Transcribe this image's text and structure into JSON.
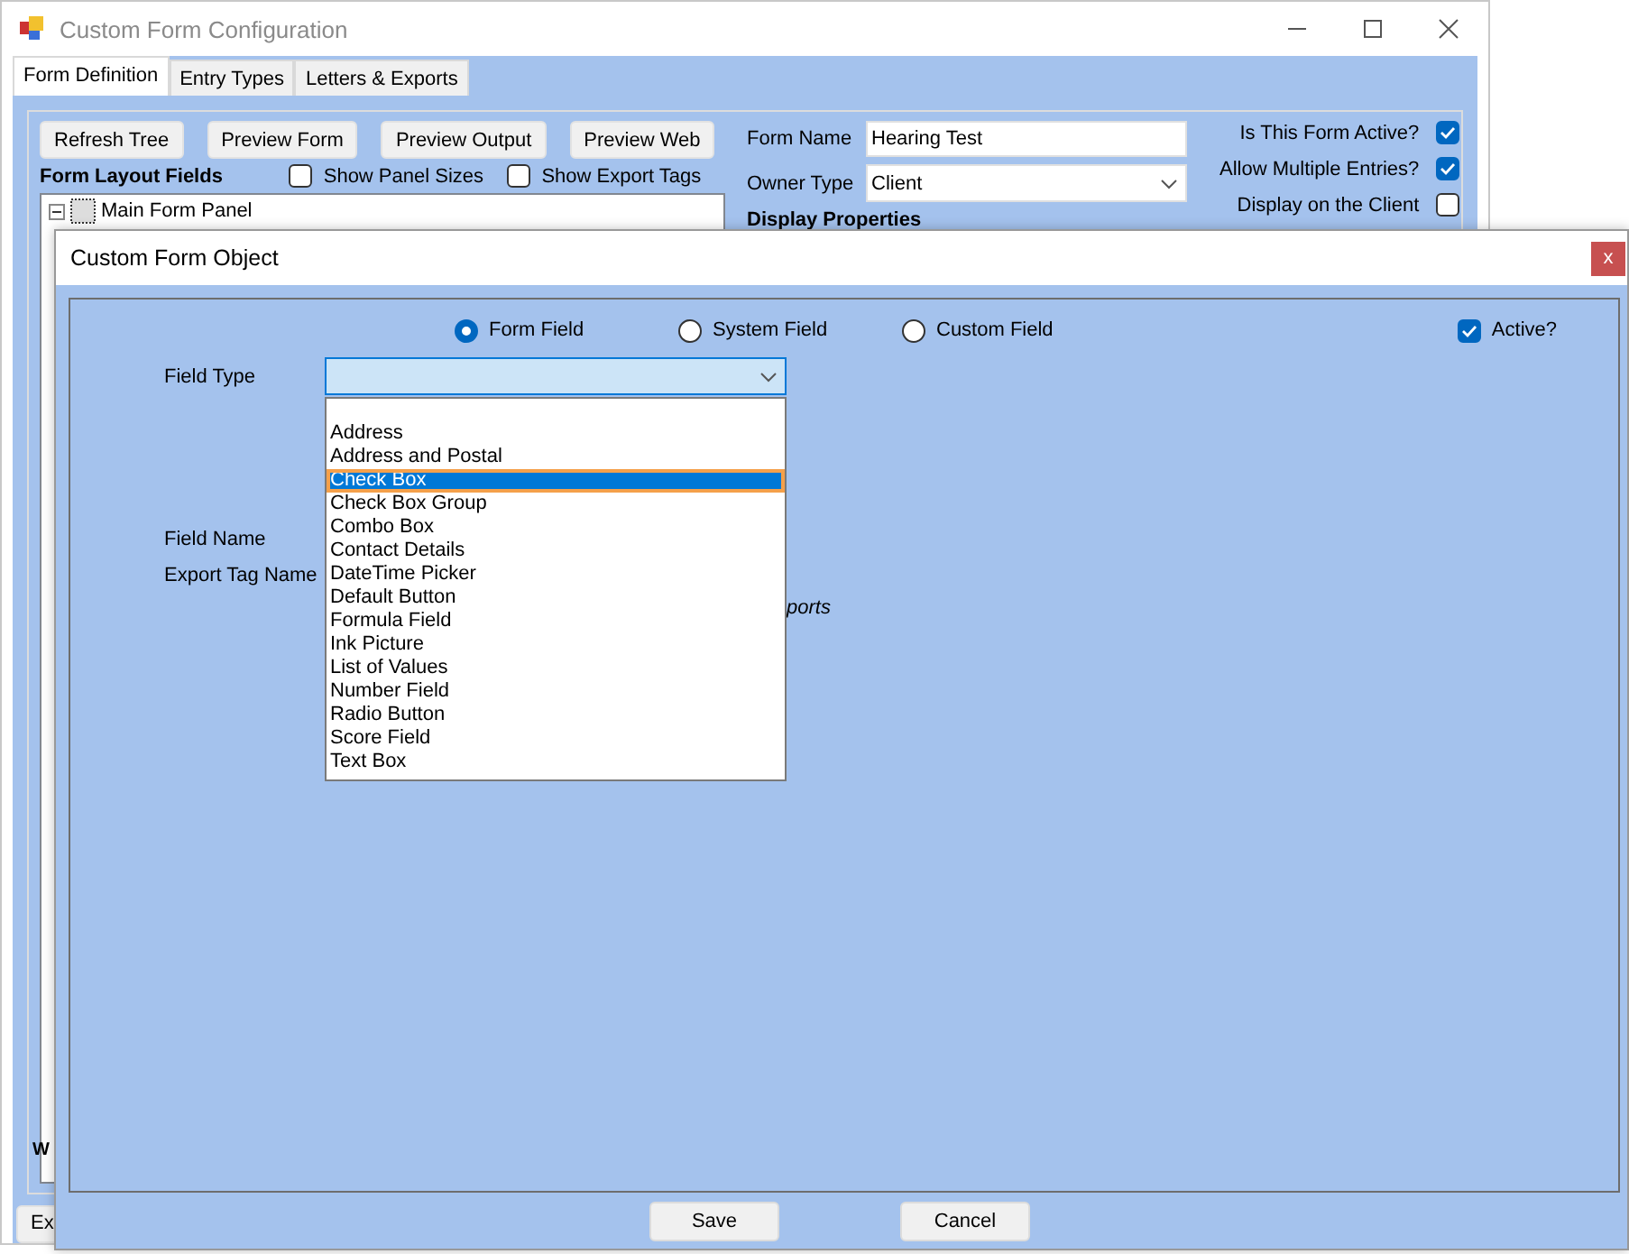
{
  "main_window": {
    "title": "Custom Form Configuration",
    "tabs": [
      {
        "label": "Form Definition",
        "selected": true
      },
      {
        "label": "Entry Types",
        "selected": false
      },
      {
        "label": "Letters & Exports",
        "selected": false
      }
    ],
    "toolbar_buttons": [
      "Refresh Tree",
      "Preview Form",
      "Preview Output",
      "Preview Web"
    ],
    "layout_heading": "Form Layout Fields",
    "layout_options": [
      {
        "label": "Show Panel Sizes",
        "checked": false
      },
      {
        "label": "Show Export Tags",
        "checked": false
      }
    ],
    "tree": [
      {
        "label": "Main Form Panel",
        "expanded": true
      }
    ],
    "form_name": {
      "label": "Form Name",
      "value": "Hearing Test"
    },
    "owner_type": {
      "label": "Owner Type",
      "value": "Client"
    },
    "display_heading": "Display Properties",
    "flags": [
      {
        "label": "Is This Form Active?",
        "checked": true
      },
      {
        "label": "Allow Multiple Entries?",
        "checked": true
      },
      {
        "label": "Display on the Client",
        "checked": false
      }
    ],
    "bottom_heading": "W",
    "bottom_button": "Ex"
  },
  "dialog": {
    "title": "Custom Form Object",
    "close": "x",
    "field_sources": [
      {
        "label": "Form Field",
        "selected": true
      },
      {
        "label": "System Field",
        "selected": false
      },
      {
        "label": "Custom Field",
        "selected": false
      }
    ],
    "active": {
      "label": "Active?",
      "checked": true
    },
    "field_type": {
      "label": "Field Type",
      "expanded": true
    },
    "field_type_options": [
      {
        "label": "Address",
        "selected": false
      },
      {
        "label": "Address and Postal",
        "selected": false
      },
      {
        "label": "Check Box",
        "selected": true
      },
      {
        "label": "Check Box Group",
        "selected": false
      },
      {
        "label": "Combo Box",
        "selected": false
      },
      {
        "label": "Contact Details",
        "selected": false
      },
      {
        "label": "DateTime Picker",
        "selected": false
      },
      {
        "label": "Default Button",
        "selected": false
      },
      {
        "label": "Formula Field",
        "selected": false
      },
      {
        "label": "Ink Picture",
        "selected": false
      },
      {
        "label": "List of Values",
        "selected": false
      },
      {
        "label": "Number Field",
        "selected": false
      },
      {
        "label": "Radio Button",
        "selected": false
      },
      {
        "label": "Score Field",
        "selected": false
      },
      {
        "label": "Text Box",
        "selected": false
      }
    ],
    "field_name_label": "Field Name",
    "export_tag_label": "Export Tag Name",
    "note": "ports",
    "buttons": [
      "Save",
      "Cancel"
    ]
  }
}
